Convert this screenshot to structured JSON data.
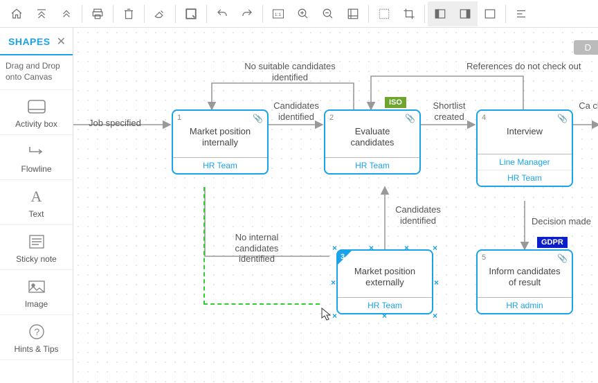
{
  "sidebar": {
    "title": "SHAPES",
    "hint": "Drag and Drop onto Canvas",
    "items": [
      {
        "label": "Activity box"
      },
      {
        "label": "Flowline"
      },
      {
        "label": "Text"
      },
      {
        "label": "Sticky note"
      },
      {
        "label": "Image"
      },
      {
        "label": "Hints & Tips"
      }
    ]
  },
  "toolbar_icons": [
    "home",
    "scroll-top",
    "scroll-up",
    "divider",
    "print",
    "divider",
    "trash",
    "divider",
    "eraser",
    "divider",
    "q-tool",
    "divider",
    "undo",
    "redo",
    "divider",
    "zoom-11",
    "zoom-in",
    "zoom-out",
    "fit",
    "divider",
    "grid",
    "crop",
    "divider",
    "panel-left",
    "panel-right",
    "panel-full",
    "divider",
    "align"
  ],
  "canvas": {
    "pill_label": "D",
    "edge_labels": {
      "job_specified": "Job specified",
      "no_suitable": "No suitable candidates identified",
      "candidates_identified_top": "Candidates identified",
      "references_fail": "References do not check out",
      "shortlist": "Shortlist created",
      "candidates_identified_mid": "Candidates identified",
      "no_internal": "No internal candidates identified",
      "decision_made": "Decision made",
      "cand_right_trunc": "Ca\ncl"
    },
    "badges": {
      "iso": "ISO",
      "gdpr": "GDPR"
    },
    "activities": [
      {
        "num": "1",
        "title": "Market position internally",
        "roles": [
          "HR Team"
        ]
      },
      {
        "num": "2",
        "title": "Evaluate candidates",
        "roles": [
          "HR Team"
        ]
      },
      {
        "num": "3",
        "title": "Market position externally",
        "roles": [
          "HR Team"
        ]
      },
      {
        "num": "4",
        "title": "Interview",
        "roles": [
          "Line Manager",
          "HR Team"
        ]
      },
      {
        "num": "5",
        "title": "Inform candidates of result",
        "roles": [
          "HR admin"
        ]
      }
    ]
  }
}
